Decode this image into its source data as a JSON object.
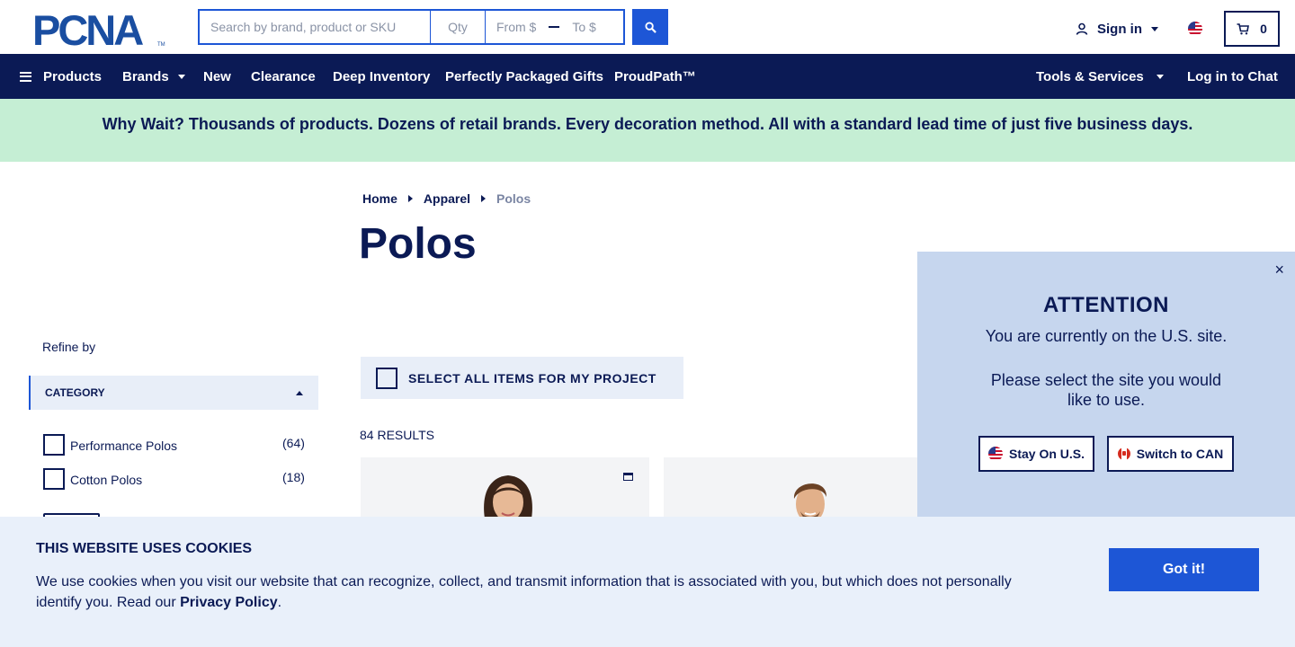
{
  "header": {
    "logo_text": "PCNA",
    "search_placeholder": "Search by brand, product or SKU",
    "qty_placeholder": "Qty",
    "price_from": "From $",
    "price_to": "To $",
    "sign_in": "Sign in",
    "cart_count": "0",
    "region_flag": "us-flag-icon"
  },
  "nav": {
    "products": "Products",
    "brands": "Brands",
    "new": "New",
    "clearance": "Clearance",
    "deep_inventory": "Deep Inventory",
    "gifts": "Perfectly Packaged Gifts",
    "proudpath": "ProudPath™",
    "tools": "Tools & Services",
    "chat": "Log in to Chat"
  },
  "banner": {
    "text": "Why Wait? Thousands of products. Dozens of retail brands. Every decoration method. All with a standard lead time of just five business days."
  },
  "breadcrumb": {
    "home": "Home",
    "apparel": "Apparel",
    "current": "Polos"
  },
  "page": {
    "title": "Polos",
    "select_all": "SELECT ALL ITEMS FOR MY PROJECT",
    "results": "84 RESULTS"
  },
  "sidebar": {
    "refine": "Refine by",
    "category_heading": "CATEGORY",
    "filters": [
      {
        "label": "Performance Polos",
        "count": "(64)"
      },
      {
        "label": "Cotton Polos",
        "count": "(18)"
      }
    ]
  },
  "attention": {
    "title": "ATTENTION",
    "line1": "You are currently on the U.S. site.",
    "line2": "Please select the site you would like to use.",
    "stay": "Stay On U.S.",
    "switch": "Switch to CAN",
    "close": "×"
  },
  "cookies": {
    "heading": "THIS WEBSITE USES COOKIES",
    "body_before": "We use cookies when you visit our website that can recognize, collect, and transmit information that is associated with you, but which does not personally identify you. Read our ",
    "privacy_link": "Privacy Policy",
    "body_after": ".",
    "button": "Got it!"
  },
  "colors": {
    "navy": "#0b1a55",
    "brand_blue": "#1d56d6",
    "banner_green": "#c5eed4",
    "popup_blue": "#c6d6ee",
    "cookie_bg": "#e9f0fa"
  }
}
